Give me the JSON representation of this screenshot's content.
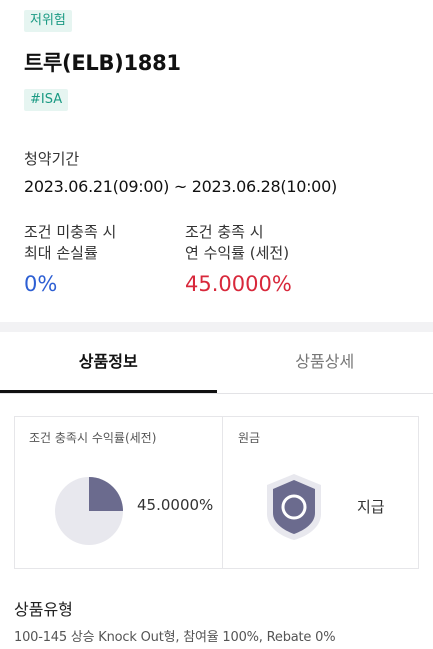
{
  "product": {
    "risk_badge": "저위험",
    "name": "트루(ELB)1881",
    "tag": "#ISA"
  },
  "subscription": {
    "label": "청약기간",
    "value": "2023.06.21(09:00) ~ 2023.06.28(10:00)"
  },
  "conditions": {
    "unmet_label_1": "조건 미충족 시",
    "unmet_label_2": "최대 손실률",
    "unmet_value": "0%",
    "met_label_1": "조건 충족 시",
    "met_label_2": "연 수익률 (세전)",
    "met_value": "45.0000%"
  },
  "tabs": [
    {
      "label": "상품정보",
      "active": true
    },
    {
      "label": "상품상세",
      "active": false
    }
  ],
  "cards": {
    "return_title": "조건 충족시 수익률(세전)",
    "return_value": "45.0000%",
    "return_fraction": 0.25,
    "principal_title": "원금",
    "principal_value": "지급"
  },
  "product_type": {
    "label": "상품유형",
    "value": "100-145 상승 Knock Out형, 참여율 100%, Rebate 0%"
  },
  "colors": {
    "accent_teal": "#1a9a83",
    "loss_blue": "#2d5fd3",
    "return_red": "#d8283b",
    "pie_fill": "#6b6b8e",
    "pie_bg": "#e8e8ee"
  }
}
